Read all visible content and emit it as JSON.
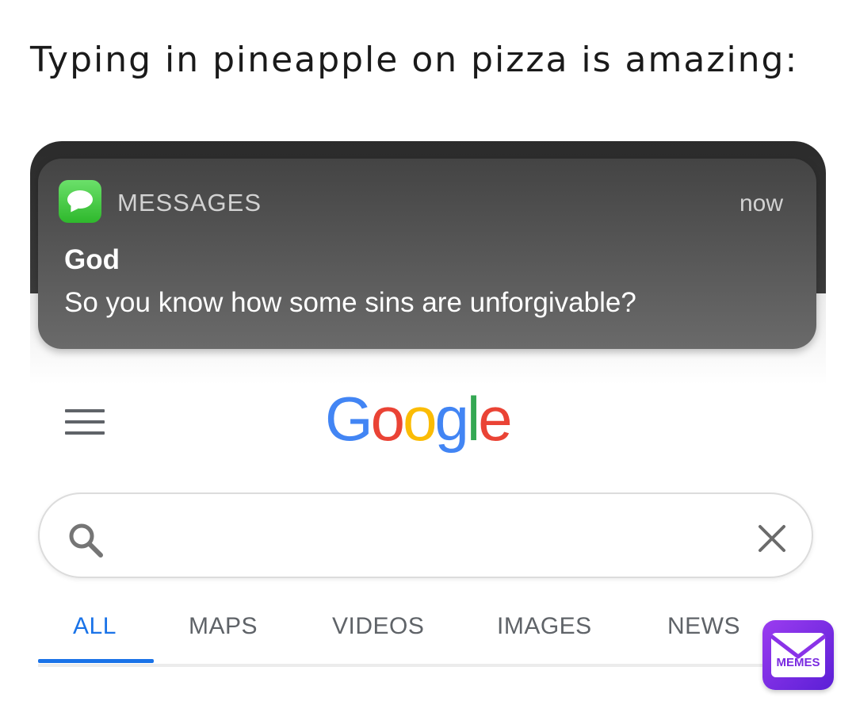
{
  "caption": "Typing in pineapple on pizza is amazing:",
  "notification": {
    "app_icon": "messages-app-icon",
    "app_name": "MESSAGES",
    "time": "now",
    "sender": "God",
    "message": "So you know how some sins are unforgivable?"
  },
  "google": {
    "menu_icon": "hamburger-menu-icon",
    "logo_letters": [
      {
        "char": "G",
        "color": "#4285F4"
      },
      {
        "char": "o",
        "color": "#EA4335"
      },
      {
        "char": "o",
        "color": "#FBBC05"
      },
      {
        "char": "g",
        "color": "#4285F4"
      },
      {
        "char": "l",
        "color": "#34A853"
      },
      {
        "char": "e",
        "color": "#EA4335"
      }
    ],
    "search": {
      "value": "",
      "search_icon": "search-icon",
      "clear_icon": "close-icon"
    },
    "tabs": [
      {
        "label": "ALL",
        "active": true
      },
      {
        "label": "MAPS",
        "active": false
      },
      {
        "label": "VIDEOS",
        "active": false
      },
      {
        "label": "IMAGES",
        "active": false
      },
      {
        "label": "NEWS",
        "active": false
      }
    ],
    "accent_color": "#1a73e8"
  },
  "watermark": {
    "icon": "memes-logo-icon",
    "text": "MEMES"
  }
}
